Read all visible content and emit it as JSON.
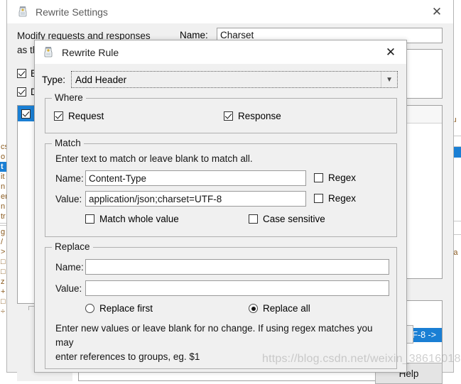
{
  "background_window": {
    "title": "Rewrite Settings",
    "icon": "charles-jar-icon",
    "close_icon": "close-icon",
    "description": "Modify requests and responses\nas th",
    "description_line1": "Modify requests and responses",
    "description_line2": "as th",
    "name_label": "Name:",
    "name_value": "Charset",
    "checkbox_1_label": "En",
    "checkbox_2_label": "De",
    "list_selected_row_label": "",
    "selected_entry_text": "F-8 ->",
    "help_label": "Help"
  },
  "app_backdrop": {
    "left_fragments": [
      "cs",
      "o",
      "t",
      "it",
      "n",
      "en",
      "n",
      "tr",
      "",
      "g",
      "/",
      ">",
      "",
      "",
      "z",
      "+",
      "",
      "÷"
    ],
    "right_fragments": [
      "cu",
      "8",
      "Èa"
    ]
  },
  "dialog": {
    "title": "Rewrite Rule",
    "icon": "charles-jar-icon",
    "close_icon": "close-icon",
    "type": {
      "label": "Type:",
      "value": "Add Header",
      "dropdown_icon": "chevron-down-icon"
    },
    "where": {
      "legend": "Where",
      "request": {
        "label": "Request",
        "checked": true
      },
      "response": {
        "label": "Response",
        "checked": true
      }
    },
    "match": {
      "legend": "Match",
      "hint": "Enter text to match or leave blank to match all.",
      "name_label": "Name:",
      "name_value": "Content-Type",
      "name_placeholder": "",
      "name_regex": {
        "label": "Regex",
        "checked": false
      },
      "value_label": "Value:",
      "value_value": "application/json;charset=UTF-8",
      "value_placeholder": "",
      "value_regex": {
        "label": "Regex",
        "checked": false
      },
      "match_whole_value": {
        "label": "Match whole value",
        "checked": false
      },
      "case_sensitive": {
        "label": "Case sensitive",
        "checked": false
      }
    },
    "replace": {
      "legend": "Replace",
      "name_label": "Name:",
      "name_value": "",
      "name_placeholder": "",
      "value_label": "Value:",
      "value_value": "",
      "value_placeholder": "",
      "replace_first": {
        "label": "Replace first",
        "selected": false
      },
      "replace_all": {
        "label": "Replace all",
        "selected": true
      },
      "hint_line1": "Enter new values or leave blank for no change. If using regex matches you may",
      "hint_line2": "enter references to groups, eg. $1"
    }
  },
  "watermark": "https://blog.csdn.net/weixin_38616018",
  "colors": {
    "accent_blue": "#1a7fd4",
    "dialog_bg": "#f0f0f0",
    "field_bg": "#ffffff",
    "border": "#b0b0b0",
    "text": "#151515"
  }
}
